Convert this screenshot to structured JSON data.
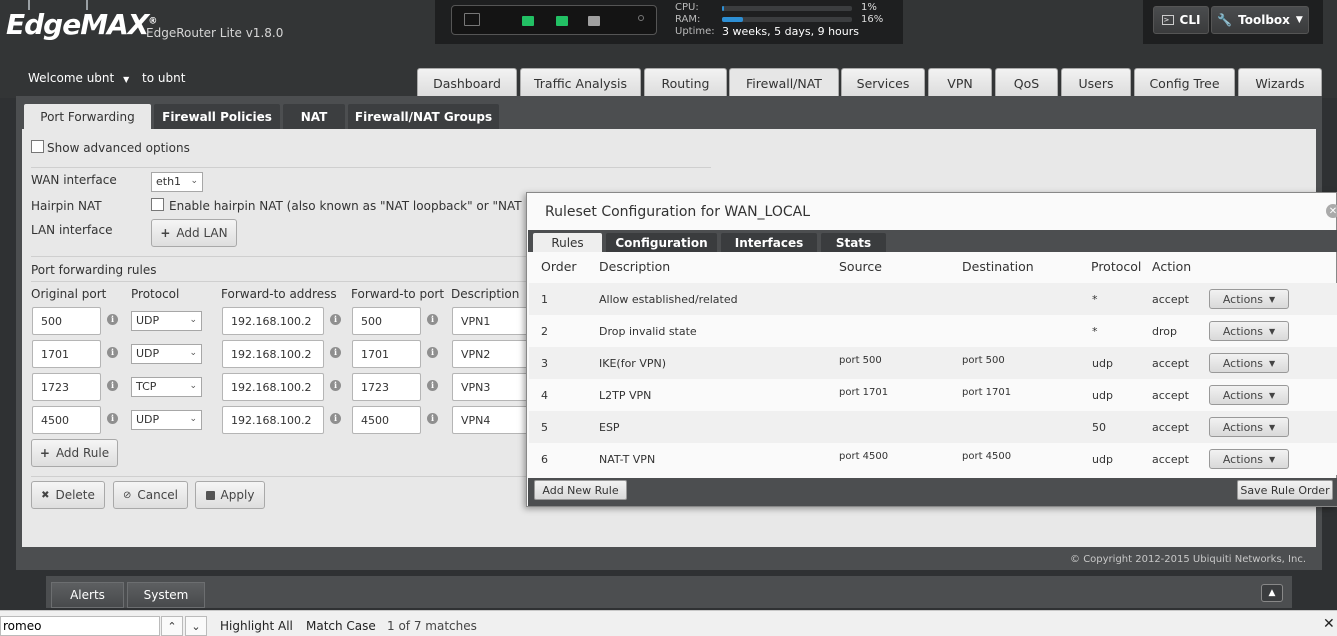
{
  "header": {
    "logo": "EdgeMAX",
    "logo_mark": "®",
    "model": "EdgeRouter Lite v1.8.0",
    "cpu_label": "CPU:",
    "cpu_value": "1%",
    "cpu_fraction": 0.01,
    "ram_label": "RAM:",
    "ram_value": "16%",
    "ram_fraction": 0.16,
    "uptime_label": "Uptime:",
    "uptime_value": "3 weeks, 5 days, 9 hours",
    "cli_label": "CLI",
    "toolbox_label": "Toolbox",
    "port_colors": [
      "#555555",
      "#22c064",
      "#22c064",
      "#a0a0a0"
    ]
  },
  "user": {
    "welcome": "Welcome ubnt",
    "to_user": "to ubnt"
  },
  "nav": {
    "tabs": [
      {
        "label": "Dashboard"
      },
      {
        "label": "Traffic Analysis"
      },
      {
        "label": "Routing"
      },
      {
        "label": "Firewall/NAT"
      },
      {
        "label": "Services"
      },
      {
        "label": "VPN"
      },
      {
        "label": "QoS"
      },
      {
        "label": "Users"
      },
      {
        "label": "Config Tree"
      },
      {
        "label": "Wizards"
      }
    ],
    "active": "Firewall/NAT"
  },
  "subtabs": [
    {
      "label": "Port Forwarding"
    },
    {
      "label": "Firewall Policies"
    },
    {
      "label": "NAT"
    },
    {
      "label": "Firewall/NAT Groups"
    }
  ],
  "port_forwarding": {
    "show_advanced": "Show advanced options",
    "wan_label": "WAN interface",
    "wan_value": "eth1",
    "hairpin_label": "Hairpin NAT",
    "hairpin_text": "Enable hairpin NAT (also known as \"NAT loopback\" or \"NAT refle",
    "lan_label": "LAN interface",
    "add_lan": "Add LAN",
    "rules_title": "Port forwarding rules",
    "columns": [
      "Original port",
      "Protocol",
      "Forward-to address",
      "Forward-to port",
      "Description"
    ],
    "rules": [
      {
        "orig": "500",
        "proto": "UDP",
        "addr": "192.168.100.2",
        "fport": "500",
        "desc": "VPN1"
      },
      {
        "orig": "1701",
        "proto": "UDP",
        "addr": "192.168.100.2",
        "fport": "1701",
        "desc": "VPN2"
      },
      {
        "orig": "1723",
        "proto": "TCP",
        "addr": "192.168.100.2",
        "fport": "1723",
        "desc": "VPN3"
      },
      {
        "orig": "4500",
        "proto": "UDP",
        "addr": "192.168.100.2",
        "fport": "4500",
        "desc": "VPN4"
      }
    ],
    "add_rule": "Add Rule",
    "delete": "Delete",
    "cancel": "Cancel",
    "apply": "Apply"
  },
  "copyright": "© Copyright 2012-2015 Ubiquiti Networks, Inc.",
  "bottom_tabs": [
    {
      "label": "Alerts"
    },
    {
      "label": "System"
    }
  ],
  "findbar": {
    "query": "romeo",
    "highlight_all": "Highlight All",
    "match_case": "Match Case",
    "matches": "1 of 7 matches"
  },
  "modal": {
    "title": "Ruleset Configuration for WAN_LOCAL",
    "tabs": [
      {
        "label": "Rules"
      },
      {
        "label": "Configuration"
      },
      {
        "label": "Interfaces"
      },
      {
        "label": "Stats"
      }
    ],
    "columns": [
      "Order",
      "Description",
      "Source",
      "Destination",
      "Protocol",
      "Action"
    ],
    "rules": [
      {
        "order": "1",
        "desc": "Allow established/related",
        "source": "",
        "dest": "",
        "proto": "*",
        "action": "accept"
      },
      {
        "order": "2",
        "desc": "Drop invalid state",
        "source": "",
        "dest": "",
        "proto": "*",
        "action": "drop"
      },
      {
        "order": "3",
        "desc": "IKE(for VPN)",
        "source": "port 500",
        "dest": "port 500",
        "proto": "udp",
        "action": "accept"
      },
      {
        "order": "4",
        "desc": "L2TP VPN",
        "source": "port 1701",
        "dest": "port 1701",
        "proto": "udp",
        "action": "accept"
      },
      {
        "order": "5",
        "desc": "ESP",
        "source": "",
        "dest": "",
        "proto": "50",
        "action": "accept"
      },
      {
        "order": "6",
        "desc": "NAT-T VPN",
        "source": "port 4500",
        "dest": "port 4500",
        "proto": "udp",
        "action": "accept"
      }
    ],
    "actions_label": "Actions",
    "add_new_rule": "Add New Rule",
    "save_rule_order": "Save Rule Order"
  }
}
